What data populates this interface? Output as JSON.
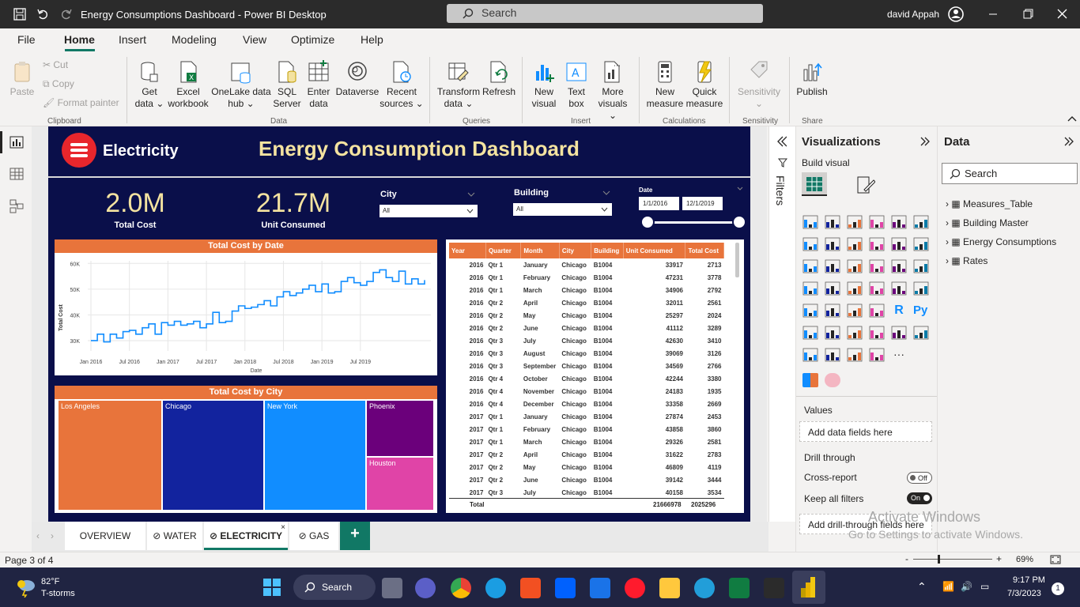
{
  "window": {
    "title": "Energy Consumptions Dashboard - Power BI Desktop",
    "search_placeholder": "Search",
    "user": "david Appah"
  },
  "menu": [
    "File",
    "Home",
    "Insert",
    "Modeling",
    "View",
    "Optimize",
    "Help"
  ],
  "ribbon": {
    "clipboard": {
      "paste": "Paste",
      "cut": "Cut",
      "copy": "Copy",
      "format_painter": "Format painter",
      "group": "Clipboard"
    },
    "data": {
      "get_data": [
        "Get",
        "data ⌄"
      ],
      "excel": [
        "Excel",
        "workbook"
      ],
      "onelake": [
        "OneLake data",
        "hub ⌄"
      ],
      "sql": [
        "SQL",
        "Server"
      ],
      "enter": [
        "Enter",
        "data"
      ],
      "dataverse": [
        "Dataverse",
        ""
      ],
      "recent": [
        "Recent",
        "sources ⌄"
      ],
      "group": "Data"
    },
    "queries": {
      "transform": [
        "Transform",
        "data ⌄"
      ],
      "refresh": [
        "Refresh",
        ""
      ],
      "group": "Queries"
    },
    "insert": {
      "new_visual": [
        "New",
        "visual"
      ],
      "text_box": [
        "Text",
        "box"
      ],
      "more_visuals": [
        "More",
        "visuals ⌄"
      ],
      "group": "Insert"
    },
    "calculations": {
      "new_measure": [
        "New",
        "measure"
      ],
      "quick_measure": [
        "Quick",
        "measure"
      ],
      "group": "Calculations"
    },
    "sensitivity": {
      "label": [
        "Sensitivity",
        "⌄"
      ],
      "group": "Sensitivity"
    },
    "share": {
      "publish": [
        "Publish",
        ""
      ],
      "group": "Share"
    }
  },
  "report": {
    "logo_text": "Electricity",
    "title": "Energy Consumption Dashboard",
    "kpi_cost": {
      "value": "2.0M",
      "label": "Total Cost"
    },
    "kpi_units": {
      "value": "21.7M",
      "label": "Unit Consumed"
    },
    "slicer_city": {
      "label": "City",
      "value": "All"
    },
    "slicer_building": {
      "label": "Building",
      "value": "All"
    },
    "slicer_date": {
      "label": "Date",
      "from": "1/1/2016",
      "to": "12/1/2019"
    }
  },
  "chart_data": [
    {
      "type": "line",
      "title": "Total Cost by Date",
      "xlabel": "Date",
      "ylabel": "Total Cost",
      "x_ticks": [
        "Jan 2016",
        "Jul 2016",
        "Jan 2017",
        "Jul 2017",
        "Jan 2018",
        "Jul 2018",
        "Jan 2019",
        "Jul 2019"
      ],
      "y_ticks": [
        "30K",
        "40K",
        "50K",
        "60K"
      ],
      "ylim": [
        26000,
        61000
      ],
      "grid": true,
      "series": [
        {
          "values": [
            30000,
            32500,
            29500,
            32500,
            31000,
            33500,
            34000,
            32500,
            35000,
            36500,
            32500,
            37000,
            36000,
            37500,
            36000,
            36500,
            37500,
            35000,
            36500,
            41000,
            37000,
            37500,
            41500,
            43500,
            42500,
            43000,
            44000,
            45500,
            43500,
            47000,
            49000,
            47500,
            48500,
            50000,
            51500,
            49000,
            52000,
            48500,
            49000,
            53000,
            54500,
            52500,
            51500,
            53000,
            56500,
            57500,
            54500,
            53000,
            57000,
            52000,
            54000,
            52000,
            53500
          ]
        }
      ]
    },
    {
      "type": "treemap",
      "title": "Total Cost by City",
      "categories": [
        "Los Angeles",
        "Chicago",
        "New York",
        "Phoenix",
        "Houston"
      ],
      "colors": [
        "#e8743b",
        "#12239e",
        "#118dff",
        "#6b007b",
        "#e044a7"
      ]
    }
  ],
  "matrix": {
    "headers": [
      "Year",
      "Quarter",
      "Month",
      "City",
      "Building",
      "Unit Consumed",
      "Total Cost"
    ],
    "rows": [
      [
        "2016",
        "Qtr 1",
        "January",
        "Chicago",
        "B1004",
        "33917",
        "2713"
      ],
      [
        "2016",
        "Qtr 1",
        "February",
        "Chicago",
        "B1004",
        "47231",
        "3778"
      ],
      [
        "2016",
        "Qtr 1",
        "March",
        "Chicago",
        "B1004",
        "34906",
        "2792"
      ],
      [
        "2016",
        "Qtr 2",
        "April",
        "Chicago",
        "B1004",
        "32011",
        "2561"
      ],
      [
        "2016",
        "Qtr 2",
        "May",
        "Chicago",
        "B1004",
        "25297",
        "2024"
      ],
      [
        "2016",
        "Qtr 2",
        "June",
        "Chicago",
        "B1004",
        "41112",
        "3289"
      ],
      [
        "2016",
        "Qtr 3",
        "July",
        "Chicago",
        "B1004",
        "42630",
        "3410"
      ],
      [
        "2016",
        "Qtr 3",
        "August",
        "Chicago",
        "B1004",
        "39069",
        "3126"
      ],
      [
        "2016",
        "Qtr 3",
        "September",
        "Chicago",
        "B1004",
        "34569",
        "2766"
      ],
      [
        "2016",
        "Qtr 4",
        "October",
        "Chicago",
        "B1004",
        "42244",
        "3380"
      ],
      [
        "2016",
        "Qtr 4",
        "November",
        "Chicago",
        "B1004",
        "24183",
        "1935"
      ],
      [
        "2016",
        "Qtr 4",
        "December",
        "Chicago",
        "B1004",
        "33358",
        "2669"
      ],
      [
        "2017",
        "Qtr 1",
        "January",
        "Chicago",
        "B1004",
        "27874",
        "2453"
      ],
      [
        "2017",
        "Qtr 1",
        "February",
        "Chicago",
        "B1004",
        "43858",
        "3860"
      ],
      [
        "2017",
        "Qtr 1",
        "March",
        "Chicago",
        "B1004",
        "29326",
        "2581"
      ],
      [
        "2017",
        "Qtr 2",
        "April",
        "Chicago",
        "B1004",
        "31622",
        "2783"
      ],
      [
        "2017",
        "Qtr 2",
        "May",
        "Chicago",
        "B1004",
        "46809",
        "4119"
      ],
      [
        "2017",
        "Qtr 2",
        "June",
        "Chicago",
        "B1004",
        "39142",
        "3444"
      ],
      [
        "2017",
        "Qtr 3",
        "July",
        "Chicago",
        "B1004",
        "40158",
        "3534"
      ]
    ],
    "total": {
      "label": "Total",
      "units": "21666978",
      "cost": "2025296"
    }
  },
  "filters_label": "Filters",
  "viz_pane": {
    "title": "Visualizations",
    "build_visual": "Build visual",
    "values": "Values",
    "add_data": "Add data fields here",
    "drill_through": "Drill through",
    "cross_report": "Cross-report",
    "cross_report_state": "Off",
    "keep_filters": "Keep all filters",
    "keep_filters_state": "On",
    "add_drill": "Add drill-through fields here"
  },
  "data_pane": {
    "title": "Data",
    "search_placeholder": "Search",
    "tables": [
      "Measures_Table",
      "Building Master",
      "Energy Consumptions",
      "Rates"
    ]
  },
  "tabs": [
    "OVERVIEW",
    "WATER",
    "ELECTRICITY",
    "GAS"
  ],
  "status": {
    "page": "Page 3 of 4",
    "zoom": "69%"
  },
  "watermark": {
    "line1": "Activate Windows",
    "line2": "Go to Settings to activate Windows."
  },
  "taskbar": {
    "temp": "82°F",
    "weather": "T-storms",
    "search": "Search",
    "time": "9:17 PM",
    "date": "7/3/2023",
    "notif": "1"
  }
}
